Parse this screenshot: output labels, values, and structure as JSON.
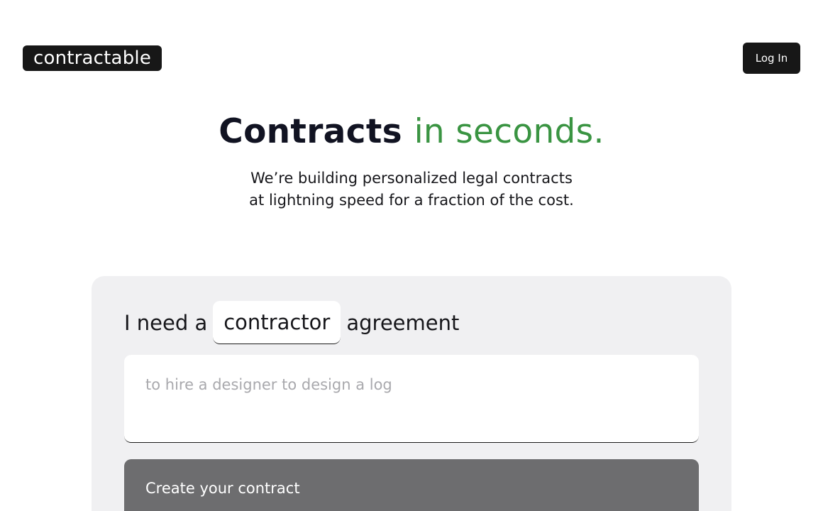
{
  "header": {
    "logo_text": "contractable",
    "login_label": "Log In"
  },
  "hero": {
    "title_main": "Contracts ",
    "title_accent": "in seconds.",
    "subtitle_line1": "We’re building personalized legal contracts",
    "subtitle_line2": "at lightning speed for a fraction of the cost."
  },
  "form": {
    "prefix": "I need a",
    "contract_type": "contractor",
    "suffix": "agreement",
    "description_placeholder": "to hire a designer to design a log",
    "description_value": "",
    "submit_label": "Create your contract"
  },
  "colors": {
    "accent": "#3a9442",
    "dark": "#171717",
    "card_bg": "#f0f0f2",
    "button_disabled": "#6d6d6f"
  }
}
